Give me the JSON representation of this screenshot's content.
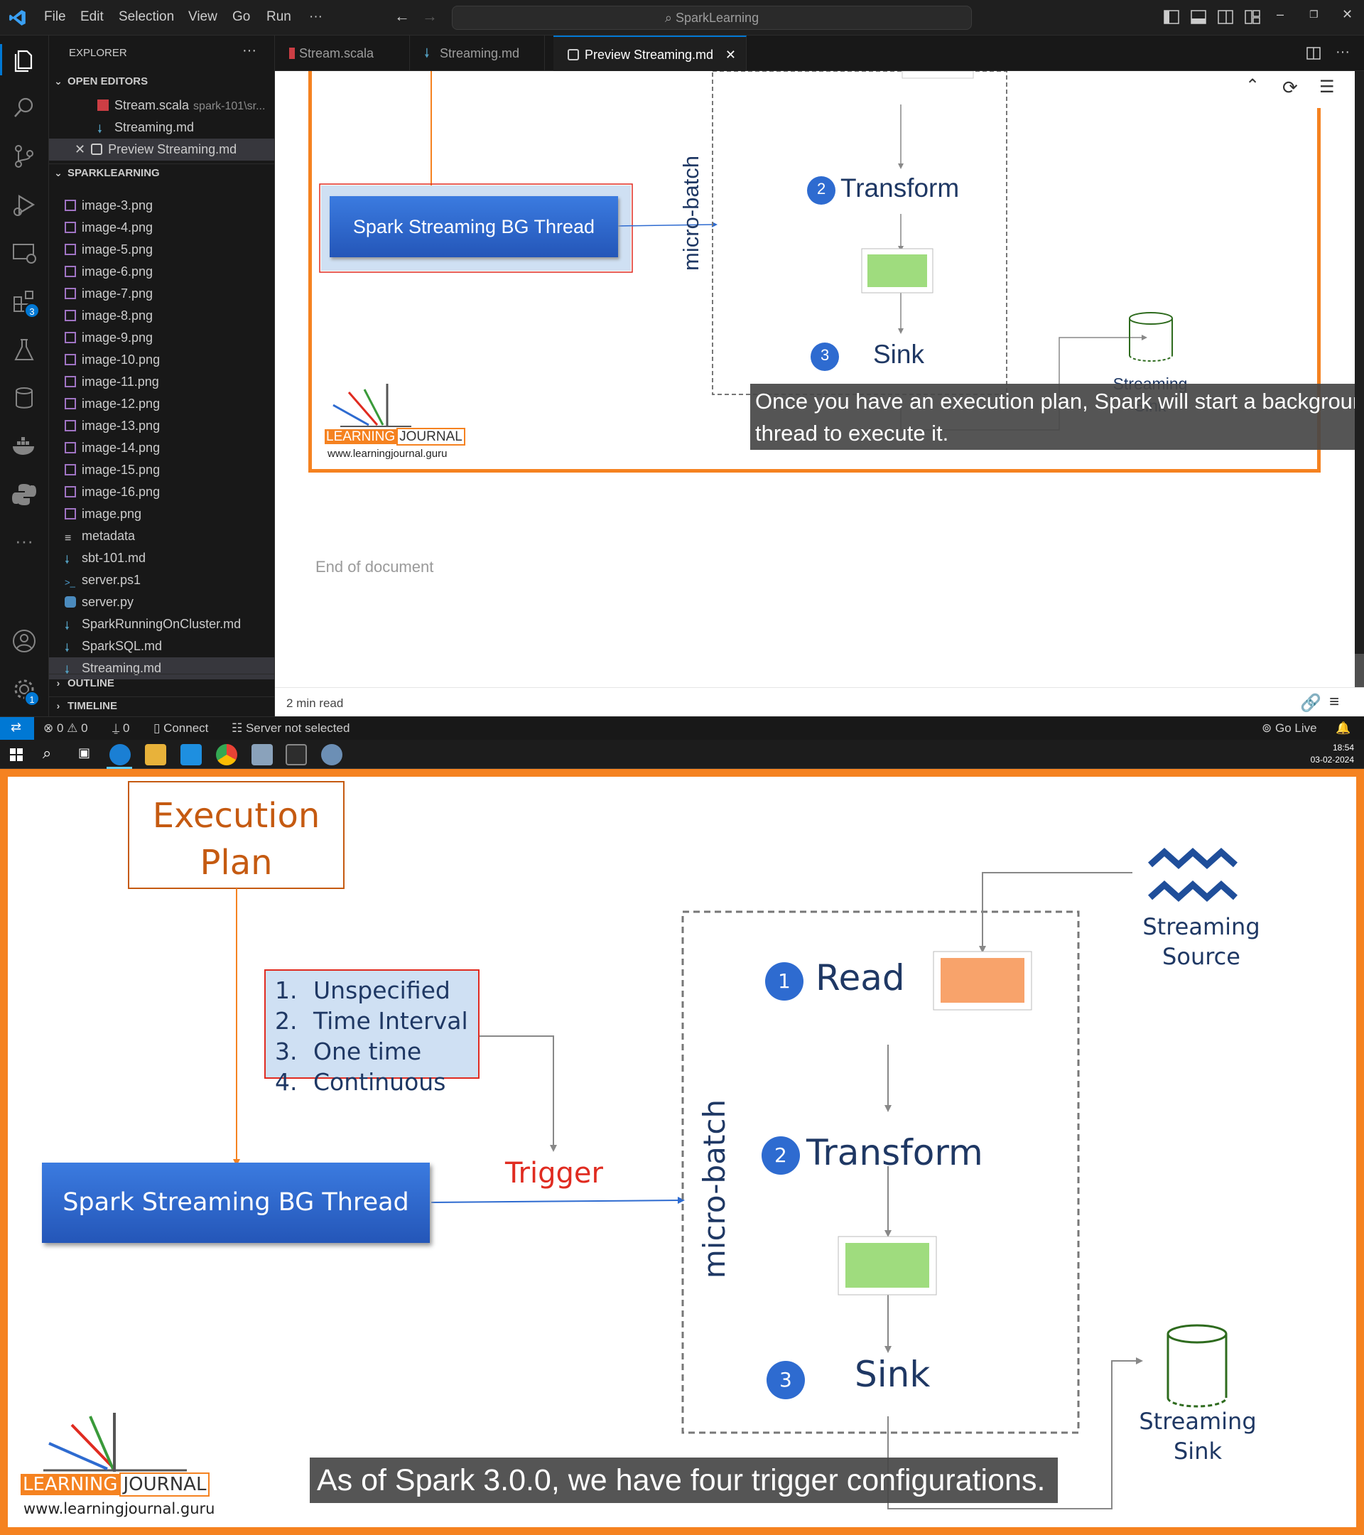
{
  "titlebar": {
    "menus": [
      "File",
      "Edit",
      "Selection",
      "View",
      "Go",
      "Run",
      "···"
    ],
    "search": "SparkLearning"
  },
  "sidebar": {
    "title": "EXPLORER",
    "more": "···",
    "open_editors_label": "OPEN EDITORS",
    "open_editors": [
      {
        "name": "Stream.scala",
        "desc": "spark-101\\sr..."
      },
      {
        "name": "Streaming.md",
        "desc": ""
      },
      {
        "name": "Preview Streaming.md",
        "desc": ""
      }
    ],
    "folder_label": "SPARKLEARNING",
    "files": [
      "image-3.png",
      "image-4.png",
      "image-5.png",
      "image-6.png",
      "image-7.png",
      "image-8.png",
      "image-9.png",
      "image-10.png",
      "image-11.png",
      "image-12.png",
      "image-13.png",
      "image-14.png",
      "image-15.png",
      "image-16.png",
      "image.png",
      "metadata",
      "sbt-101.md",
      "server.ps1",
      "server.py",
      "SparkRunningOnCluster.md",
      "SparkSQL.md",
      "Streaming.md"
    ],
    "outline_label": "OUTLINE",
    "timeline_label": "TIMELINE"
  },
  "activity_badges": {
    "extensions": "3",
    "settings": "1"
  },
  "tabs": [
    "Stream.scala",
    "Streaming.md",
    "Preview Streaming.md"
  ],
  "preview": {
    "transform": "Transform",
    "sink": "Sink",
    "num2": "2",
    "num3": "3",
    "bg_thread": "Spark Streaming BG Thread",
    "micro_batch": "micro-batch",
    "streaming_sink": "Streaming Sink",
    "caption": "Once you have an execution plan, Spark will start a background thread to execute it.",
    "logo_a": "LEARNING",
    "logo_b": "JOURNAL",
    "logo_url": "www.learningjournal.guru",
    "end_of_doc": "End of document",
    "read_time": "2 min read"
  },
  "status": {
    "errors": "0",
    "warnings": "0",
    "ports": "0",
    "connect": "Connect",
    "server": "Server not selected",
    "go_live": "Go Live"
  },
  "clock": {
    "time": "18:54",
    "date": "03-02-2024"
  },
  "slide": {
    "exec_plan_1": "Execution",
    "exec_plan_2": "Plan",
    "triggers": [
      {
        "n": "1.",
        "label": "Unspecified"
      },
      {
        "n": "2.",
        "label": "Time Interval"
      },
      {
        "n": "3.",
        "label": "One time"
      },
      {
        "n": "4.",
        "label": "Continuous"
      }
    ],
    "trigger": "Trigger",
    "bg_thread": "Spark Streaming BG Thread",
    "micro_batch": "micro-batch",
    "read": "Read",
    "transform": "Transform",
    "sink": "Sink",
    "n1": "1",
    "n2": "2",
    "n3": "3",
    "source_1": "Streaming",
    "source_2": "Source",
    "sink_1": "Streaming",
    "sink_2": "Sink",
    "caption": "As of Spark 3.0.0, we have four trigger configurations.",
    "logo_a": "LEARNING",
    "logo_b": "JOURNAL",
    "logo_url": "www.learningjournal.guru"
  },
  "colors": {
    "accent": "#0078d4",
    "slide_border": "#f58220",
    "bg_thread_blue": "#2e6bd0",
    "trigger_red": "#e02b20",
    "diagram_navy": "#1f3864"
  }
}
